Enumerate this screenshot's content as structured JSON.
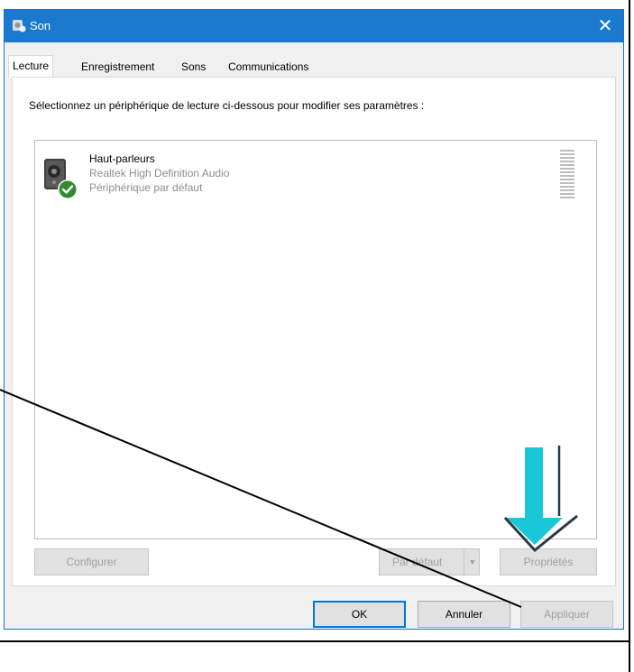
{
  "window": {
    "title": "Son",
    "close_glyph": "✕"
  },
  "tabs": [
    {
      "label": "Lecture",
      "active": true
    },
    {
      "label": "Enregistrement",
      "active": false
    },
    {
      "label": "Sons",
      "active": false
    },
    {
      "label": "Communications",
      "active": false
    }
  ],
  "panel": {
    "instruction": "Sélectionnez un périphérique de lecture ci-dessous pour modifier ses paramètres :"
  },
  "device": {
    "name": "Haut-parleurs",
    "driver": "Realtek High Definition Audio",
    "status": "Périphérique par défaut",
    "icon": "speaker-icon",
    "badge_icon": "default-check-icon"
  },
  "panel_buttons": {
    "configure": "Configurer",
    "set_default": "Par défaut",
    "properties": "Propriétés"
  },
  "dialog_buttons": {
    "ok": "OK",
    "cancel": "Annuler",
    "apply": "Appliquer"
  },
  "annotation": {
    "arrow_color": "#1ac7d6",
    "line_color": "#000000"
  },
  "colors": {
    "titlebar": "#1b7ad0",
    "check_badge": "#2e8b2e",
    "disabled_text": "#a0a0a0"
  }
}
